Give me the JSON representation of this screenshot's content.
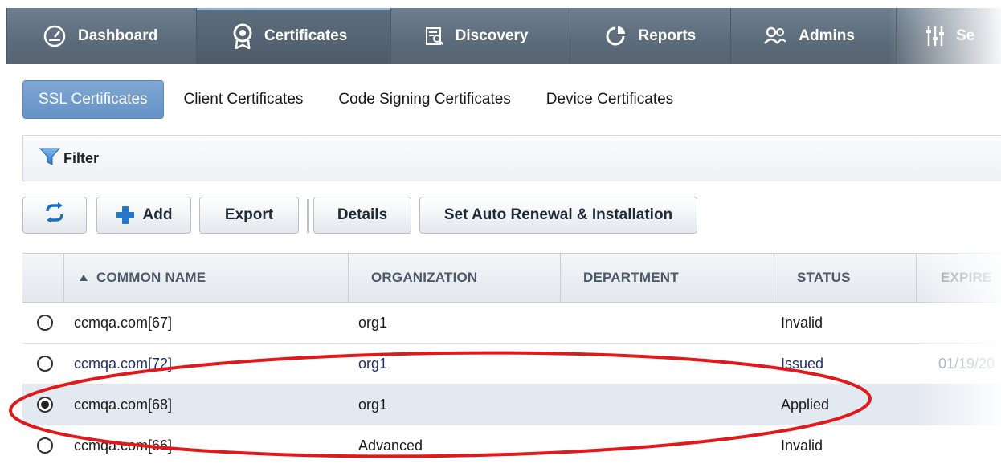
{
  "nav": {
    "items": [
      {
        "label": "Dashboard",
        "icon": "dashboard-gauge-icon"
      },
      {
        "label": "Certificates",
        "icon": "certificate-award-icon"
      },
      {
        "label": "Discovery",
        "icon": "discovery-scan-icon"
      },
      {
        "label": "Reports",
        "icon": "reports-pie-icon"
      },
      {
        "label": "Admins",
        "icon": "admins-users-icon"
      },
      {
        "label": "Se",
        "icon": "settings-sliders-icon"
      }
    ],
    "active_index": 1
  },
  "subtabs": [
    "SSL Certificates",
    "Client Certificates",
    "Code Signing Certificates",
    "Device Certificates"
  ],
  "filter": {
    "label": "Filter",
    "icon": "filter-funnel-icon"
  },
  "toolbar": {
    "refresh_icon": "refresh-icon",
    "add_label": "Add",
    "export_label": "Export",
    "details_label": "Details",
    "auto_renew_label": "Set Auto Renewal & Installation"
  },
  "table": {
    "columns": [
      "COMMON NAME",
      "ORGANIZATION",
      "DEPARTMENT",
      "STATUS",
      "EXPIRE"
    ],
    "sort_column": "COMMON NAME",
    "sort_direction": "ascending",
    "rows": [
      {
        "common_name": "ccmqa.com[67]",
        "organization": "org1",
        "department": "",
        "status": "Invalid",
        "expires": "",
        "selected": false
      },
      {
        "common_name": "ccmqa.com[72]",
        "organization": "org1",
        "department": "",
        "status": "Issued",
        "expires": "01/19/20",
        "selected": false
      },
      {
        "common_name": "ccmqa.com[68]",
        "organization": "org1",
        "department": "",
        "status": "Applied",
        "expires": "",
        "selected": true
      },
      {
        "common_name": "ccmqa.com[66]",
        "organization": "Advanced",
        "department": "",
        "status": "Invalid",
        "expires": "",
        "selected": false
      }
    ]
  },
  "colors": {
    "nav_bg": "#5c6b7a",
    "active_tab": "#6593c6",
    "highlight_oval": "#e0191b"
  }
}
